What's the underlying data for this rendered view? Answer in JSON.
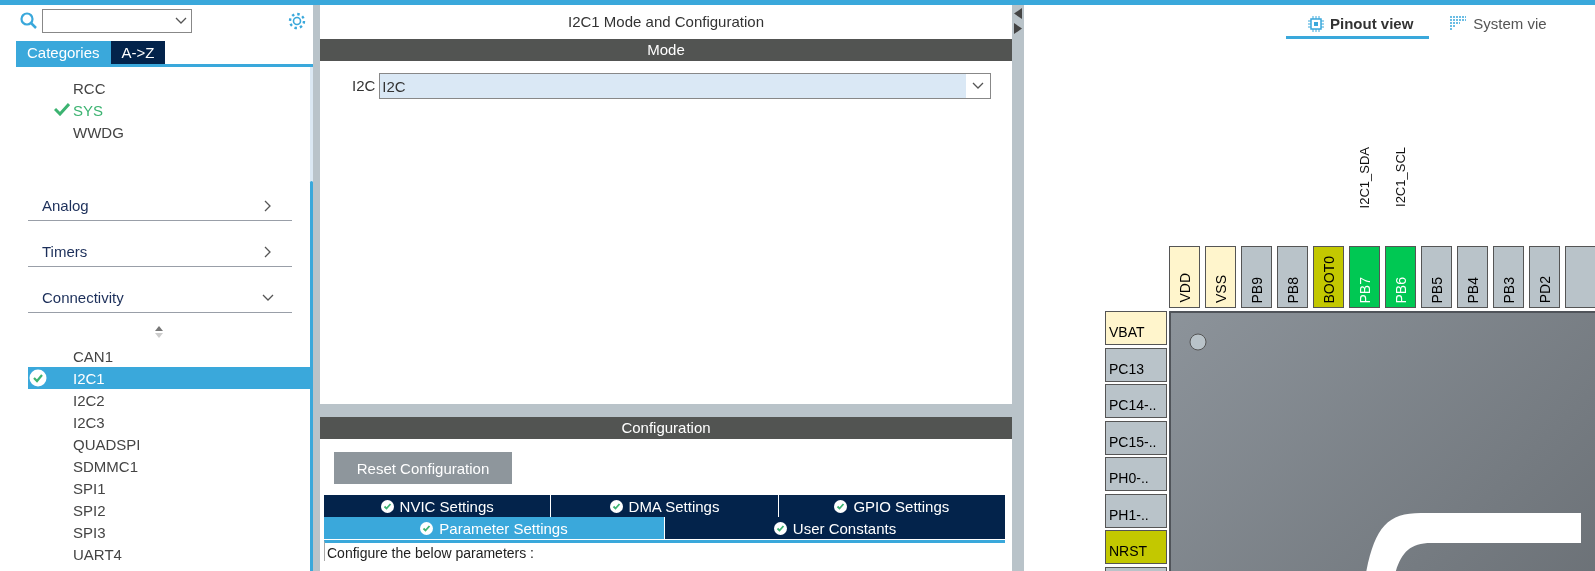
{
  "left_panel": {
    "view_tabs": [
      {
        "label": "Categories",
        "selected": true
      },
      {
        "label": "A->Z",
        "selected": false
      }
    ],
    "top_items": [
      {
        "label": "RCC",
        "checked": false
      },
      {
        "label": "SYS",
        "checked": true
      },
      {
        "label": "WWDG",
        "checked": false
      }
    ],
    "categories": [
      {
        "label": "Analog",
        "expanded": false
      },
      {
        "label": "Timers",
        "expanded": false
      },
      {
        "label": "Connectivity",
        "expanded": true
      }
    ],
    "connectivity_items": [
      {
        "label": "CAN1",
        "checked": false,
        "selected": false
      },
      {
        "label": "I2C1",
        "checked": true,
        "selected": true
      },
      {
        "label": "I2C2",
        "checked": false,
        "selected": false
      },
      {
        "label": "I2C3",
        "checked": false,
        "selected": false
      },
      {
        "label": "QUADSPI",
        "checked": false,
        "selected": false
      },
      {
        "label": "SDMMC1",
        "checked": false,
        "selected": false
      },
      {
        "label": "SPI1",
        "checked": false,
        "selected": false
      },
      {
        "label": "SPI2",
        "checked": false,
        "selected": false
      },
      {
        "label": "SPI3",
        "checked": false,
        "selected": false
      },
      {
        "label": "UART4",
        "checked": false,
        "selected": false
      }
    ]
  },
  "config_panel": {
    "title": "I2C1 Mode and Configuration",
    "mode_header": "Mode",
    "mode_field": {
      "label": "I2C",
      "value": "I2C"
    },
    "config_header": "Configuration",
    "reset_button": "Reset Configuration",
    "tab_rows": [
      {
        "tabs": [
          {
            "label": "NVIC Settings",
            "selected": false
          },
          {
            "label": "DMA Settings",
            "selected": false
          },
          {
            "label": "GPIO Settings",
            "selected": false
          }
        ]
      },
      {
        "tabs": [
          {
            "label": "Parameter Settings",
            "selected": true
          },
          {
            "label": "User Constants",
            "selected": false
          }
        ]
      }
    ],
    "hint": "Configure the below parameters :"
  },
  "pinout_panel": {
    "view_tabs": [
      {
        "label": "Pinout view",
        "selected": true
      },
      {
        "label": "System vie",
        "selected": false
      }
    ],
    "top_pins": [
      {
        "label": "VDD",
        "kind": "power"
      },
      {
        "label": "VSS",
        "kind": "power"
      },
      {
        "label": "PB9",
        "kind": "io"
      },
      {
        "label": "PB8",
        "kind": "io"
      },
      {
        "label": "BOOT0",
        "kind": "boot"
      },
      {
        "label": "PB7",
        "kind": "assigned",
        "signal": "I2C1_SDA"
      },
      {
        "label": "PB6",
        "kind": "assigned",
        "signal": "I2C1_SCL"
      },
      {
        "label": "PB5",
        "kind": "io"
      },
      {
        "label": "PB4",
        "kind": "io"
      },
      {
        "label": "PB3",
        "kind": "io"
      },
      {
        "label": "PD2",
        "kind": "io"
      }
    ],
    "left_pins": [
      {
        "label": "VBAT",
        "kind": "power"
      },
      {
        "label": "PC13",
        "kind": "io"
      },
      {
        "label": "PC14-..",
        "kind": "io"
      },
      {
        "label": "PC15-..",
        "kind": "io"
      },
      {
        "label": "PH0-..",
        "kind": "io"
      },
      {
        "label": "PH1-..",
        "kind": "io"
      },
      {
        "label": "NRST",
        "kind": "boot"
      }
    ]
  }
}
